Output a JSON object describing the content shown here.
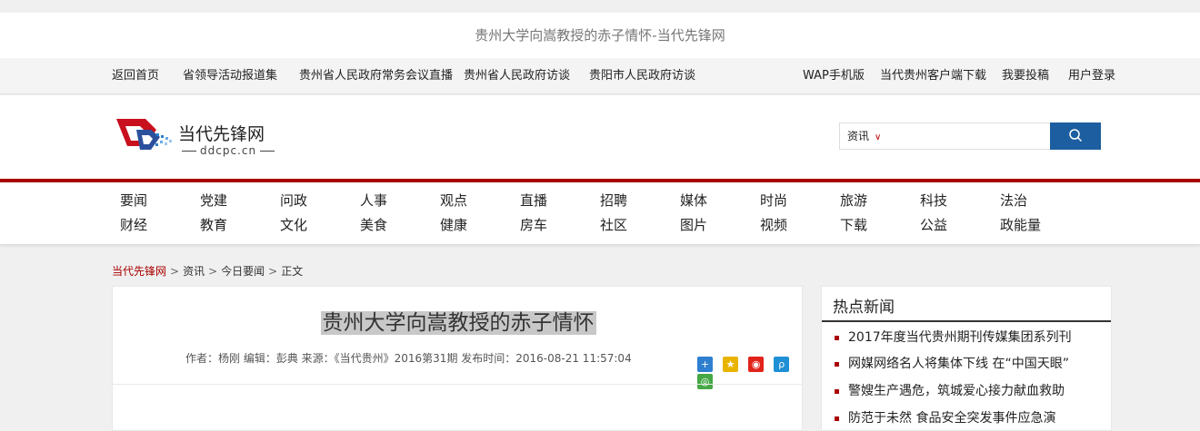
{
  "page": {
    "title": "贵州大学向嵩教授的赤子情怀-当代先锋网"
  },
  "topnav": {
    "left": [
      "返回首页",
      "省领导活动报道集",
      "贵州省人民政府常务会议直播",
      "贵州省人民政府访谈",
      "贵阳市人民政府访谈"
    ],
    "right": [
      "WAP手机版",
      "当代贵州客户端下载",
      "我要投稿",
      "用户登录"
    ]
  },
  "header": {
    "logo_text": "当代先锋网",
    "logo_sub": "ddcpc.cn",
    "search_scope": "资讯",
    "search_placeholder": "",
    "search_icon": "search-icon"
  },
  "catnav": {
    "row1": [
      "要闻",
      "党建",
      "问政",
      "人事",
      "观点",
      "直播",
      "招聘",
      "媒体",
      "时尚",
      "旅游",
      "科技",
      "法治"
    ],
    "row2": [
      "财经",
      "教育",
      "文化",
      "美食",
      "健康",
      "房车",
      "社区",
      "图片",
      "视频",
      "下载",
      "公益",
      "政能量"
    ]
  },
  "breadcrumb": {
    "home": "当代先锋网",
    "sep": ">",
    "l1": "资讯",
    "l2": "今日要闻",
    "l3": "正文"
  },
  "article": {
    "title": "贵州大学向嵩教授的赤子情怀",
    "meta": "作者：杨刚 编辑：彭典 来源：《当代贵州》2016第31期 发布时间：2016-08-21 11:57:04",
    "share_icons": [
      "share-more-icon",
      "qzone-icon",
      "weibo-icon",
      "tencent-weibo-icon",
      "wechat-icon"
    ]
  },
  "sidebar": {
    "title": "热点新闻",
    "items": [
      "2017年度当代贵州期刊传媒集团系列刊",
      "网媒网络名人将集体下线 在“中国天眼”",
      "警嫂生产遇危，筑城爱心接力献血救助",
      "防范于未然 食品安全突发事件应急演"
    ]
  },
  "colors": {
    "accent_red": "#a90000",
    "search_blue": "#1c5e9f"
  }
}
